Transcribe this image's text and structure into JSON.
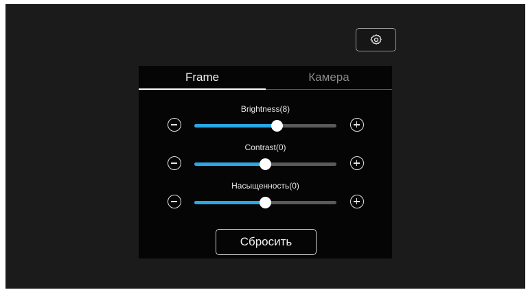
{
  "header": {
    "settings_icon": "gear-icon"
  },
  "tabs": [
    {
      "label": "Frame",
      "active": true
    },
    {
      "label": "Камера",
      "active": false
    }
  ],
  "sliders": [
    {
      "label": "Brightness(8)",
      "level": 0.58
    },
    {
      "label": "Contrast(0)",
      "level": 0.5
    },
    {
      "label": "Насыщенность(0)",
      "level": 0.5
    }
  ],
  "reset_label": "Сбросить",
  "colors": {
    "accent": "#2aa8e6",
    "track": "#5a5a5a",
    "background": "#1b1b1b",
    "panel": "#050505"
  }
}
